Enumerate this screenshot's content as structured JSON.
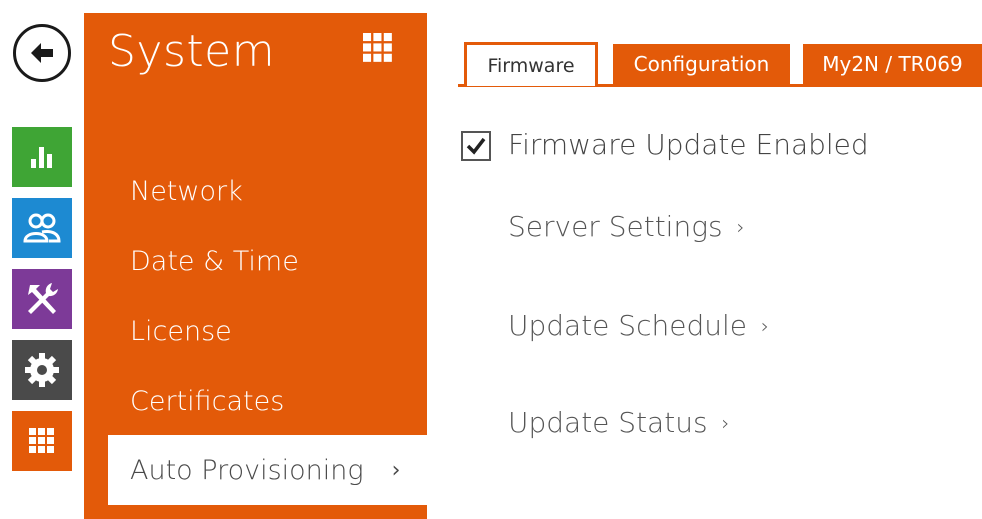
{
  "nav": {
    "back_icon": "arrow-left-icon",
    "tiles": [
      {
        "name": "status",
        "icon": "bar-chart-icon",
        "color": "#3fa535"
      },
      {
        "name": "directory",
        "icon": "users-icon",
        "color": "#1d8ad2"
      },
      {
        "name": "hardware",
        "icon": "tools-icon",
        "color": "#7d3a98"
      },
      {
        "name": "services",
        "icon": "gear-icon",
        "color": "#4a4a4a"
      },
      {
        "name": "system",
        "icon": "grid-icon",
        "color": "#e35a09"
      }
    ]
  },
  "system_menu": {
    "title": "System",
    "accent": "#e35a09",
    "items": [
      {
        "label": "Network"
      },
      {
        "label": "Date & Time"
      },
      {
        "label": "License"
      },
      {
        "label": "Certificates"
      },
      {
        "label": "Auto Provisioning",
        "active": true,
        "chevron": "›"
      }
    ]
  },
  "tabs": [
    {
      "label": "Firmware",
      "active": true
    },
    {
      "label": "Configuration"
    },
    {
      "label": "My2N / TR069"
    }
  ],
  "content": {
    "firmware_update_enabled": {
      "label": "Firmware Update Enabled",
      "checked": true
    },
    "links": [
      {
        "label": "Server Settings",
        "chevron": "›"
      },
      {
        "label": "Update Schedule",
        "chevron": "›"
      },
      {
        "label": "Update Status",
        "chevron": "›"
      }
    ]
  }
}
